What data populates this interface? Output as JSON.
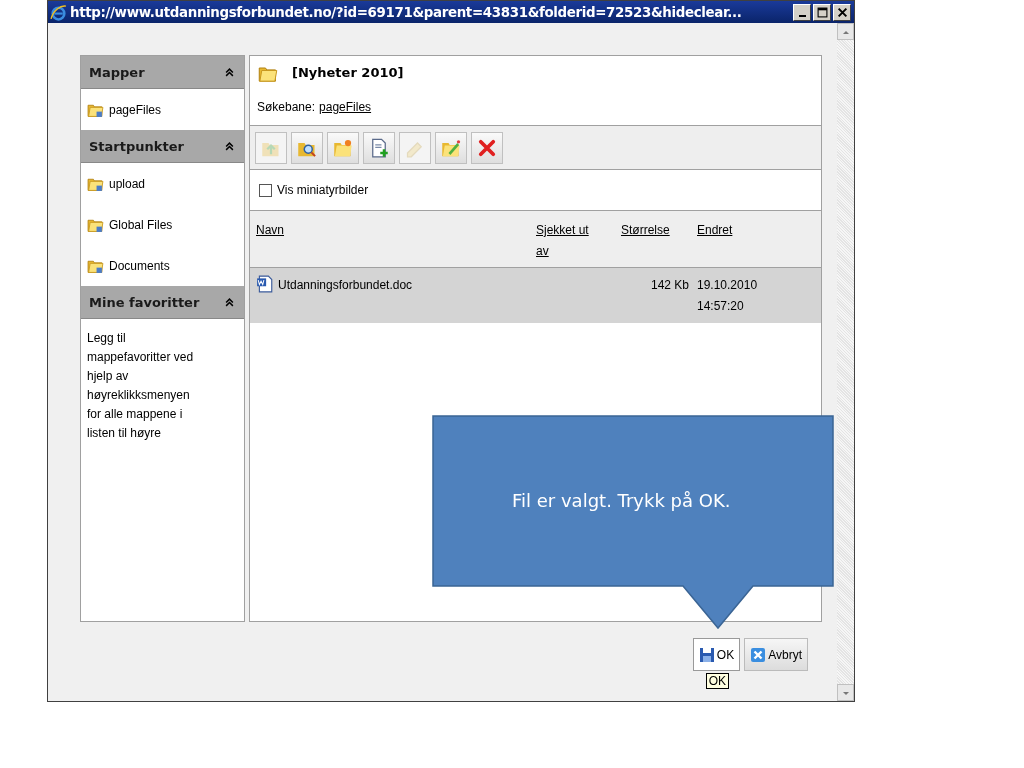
{
  "window": {
    "title": "http://www.utdanningsforbundet.no/?id=69171&parent=43831&folderid=72523&hideclear..."
  },
  "sidebar": {
    "sections": [
      {
        "title": "Mapper",
        "kind": "folders",
        "items": [
          "pageFiles"
        ]
      },
      {
        "title": "Startpunkter",
        "kind": "folders",
        "items": [
          "upload",
          "Global Files",
          "Documents"
        ]
      },
      {
        "title": "Mine favoritter",
        "kind": "note",
        "text": "Legg til mappefavoritter ved hjelp av høyreklikksmenyen for alle mappene i listen til høyre"
      }
    ]
  },
  "folder": {
    "title": "[Nyheter 2010]",
    "path_label": "Søkebane:",
    "path_link": "pageFiles"
  },
  "toolbar": [
    {
      "kind": "up",
      "disabled": true
    },
    {
      "kind": "search",
      "disabled": false
    },
    {
      "kind": "new-folder",
      "disabled": false
    },
    {
      "kind": "new-file",
      "disabled": false
    },
    {
      "kind": "rename",
      "disabled": true
    },
    {
      "kind": "edit",
      "disabled": false
    },
    {
      "kind": "delete",
      "disabled": false
    }
  ],
  "thumbnails": {
    "label": "Vis miniatyrbilder",
    "checked": false
  },
  "table": {
    "columns": [
      "Navn",
      "Sjekket ut av",
      "Størrelse",
      "Endret"
    ],
    "rows": [
      {
        "name": "Utdanningsforbundet.doc",
        "checked_out_by": "",
        "size": "142 Kb",
        "modified_date": "19.10.2010",
        "modified_time": "14:57:20",
        "selected": true
      }
    ]
  },
  "buttons": [
    {
      "kind": "save",
      "label": "OK"
    },
    {
      "kind": "cancel",
      "label": "Avbryt"
    }
  ],
  "tooltip": "OK",
  "callout": "Fil er valgt. Trykk på OK."
}
